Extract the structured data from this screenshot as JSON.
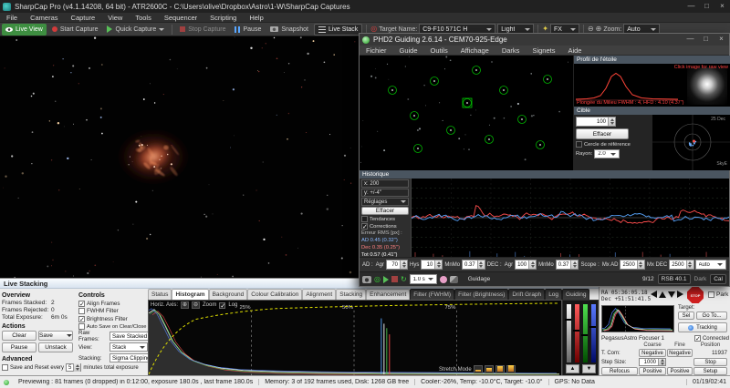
{
  "colors": {
    "accent_green": "#3e8e41",
    "ra_blue": "#58a6ff",
    "dec_red": "#ff4d4d",
    "stretch_yellow": "#e2e200",
    "stop_red": "#cf1f1f"
  },
  "sharpcap": {
    "title": "SharpCap Pro (v4.1.14208, 64 bit) - ATR2600C - C:\\Users\\olive\\Dropbox\\Astro\\1-W\\SharpCap Captures",
    "menus": [
      "File",
      "Cameras",
      "Capture",
      "View",
      "Tools",
      "Sequencer",
      "Scripting",
      "Help"
    ],
    "toolbar": {
      "live_view": "Live View",
      "start_capture": "Start Capture",
      "quick_capture": "Quick Capture",
      "stop_capture": "Stop Capture",
      "pause": "Pause",
      "snapshot": "Snapshot",
      "live_stack": "Live Stack",
      "target_name_label": "Target Name:",
      "target_name_value": "C9-F10 571C H",
      "frame_type_value": "Light",
      "fx_label": "FX",
      "zoom_label": "Zoom:",
      "zoom_value": "Auto"
    }
  },
  "phd2": {
    "title": "PHD2 Guiding 2.6.14 - CEM70-925-Edge",
    "menus": [
      "Fichier",
      "Guide",
      "Outils",
      "Affichage",
      "Darks",
      "Signets",
      "Aide"
    ],
    "star_profile": {
      "title": "Profil de l'étoile",
      "click_hint": "Click image for raw view",
      "fwhm_text": "Plongée du Milieu FWHM : 4, HFD : 4.10 (4.37\")"
    },
    "target": {
      "title": "Cible",
      "zoom_value": "100",
      "clear_button": "Effacer",
      "ref_circle_label": "Cercle de référence",
      "radius_label": "Rayon:",
      "radius_value": "2.0",
      "scale_label": "25 Dec",
      "east_label": "SkyE"
    },
    "graph": {
      "title": "Historique",
      "x_scale_label": "x: 200",
      "y_scale_label": "y: +/-4\"",
      "settings_button": "Réglages",
      "clear_button": "Effacer",
      "trends_label": "Tendances",
      "corrections_label": "Corrections",
      "rms_title": "Erreur RMS [px] :",
      "rms_ra": "AD 0.45 (0.32\")",
      "rms_dec": "Dec 0.35 (0.25\")",
      "rms_tot": "Tot 0.57 (0.41\")"
    },
    "params": {
      "ra_label": "AD :",
      "ra_agr_label": "Agr",
      "ra_agr_value": "70",
      "ra_hys_label": "Hys",
      "ra_hys_value": "10",
      "ra_mnmo_label": "MnMo",
      "ra_mnmo_value": "0.37",
      "dec_label": "DEC :",
      "dec_agr_label": "Agr",
      "dec_agr_value": "100",
      "dec_mnmo_label": "MnMo",
      "dec_mnmo_value": "0.37",
      "scope_label": "Scope :",
      "mxad_label": "Mx AD",
      "mxad_value": "2500",
      "mxdec_label": "Mx DEC",
      "mxdec_value": "2500",
      "mode_value": "Auto"
    },
    "footer": {
      "exposure_value": "1.0 s",
      "status_text": "Guidage",
      "frames_text": "9/12",
      "snr_text": "RSB 40.1",
      "dark_label": "Dark",
      "cal_label": "Cal"
    }
  },
  "live_stacking": {
    "panel_title": "Live Stacking",
    "overview": {
      "title": "Overview",
      "rows": [
        {
          "label": "Frames Stacked:",
          "value": "2"
        },
        {
          "label": "Frames Rejected:",
          "value": "0"
        },
        {
          "label": "Total Exposure:",
          "value": "6m 0s"
        }
      ]
    },
    "actions": {
      "title": "Actions",
      "buttons": [
        "Clear",
        "Save",
        "Pause",
        "Unstack"
      ]
    },
    "advanced": {
      "title": "Advanced",
      "save_reset_prefix": "Save and Reset every",
      "save_reset_value": "5",
      "save_reset_suffix": "minutes total exposure"
    },
    "controls": {
      "title": "Controls",
      "checkboxes": [
        {
          "label": "Align Frames",
          "checked": true
        },
        {
          "label": "FWHM Filter",
          "checked": false
        },
        {
          "label": "Brightness Filter",
          "checked": true
        },
        {
          "label": "Auto Save on Clear/Close",
          "checked": false
        }
      ],
      "dropdowns": [
        {
          "label": "Raw Frames:",
          "value": "Save Stacked"
        },
        {
          "label": "View:",
          "value": "Stack"
        },
        {
          "label": "Stacking:",
          "value": "Sigma Clipping"
        }
      ]
    },
    "tabs": [
      "Status",
      "Histogram",
      "Background",
      "Colour Calibration",
      "Alignment",
      "Stacking",
      "Enhancement",
      "Filter (FWHM)",
      "Filter (Brightness)",
      "Drift Graph",
      "Log",
      "Guiding"
    ],
    "selected_tab": "Histogram",
    "histogram": {
      "horiz_axis_label": "Horiz. Axis:",
      "zoom_label": "Zoom",
      "log_label": "Log",
      "percent_labels": [
        "25%",
        "50%",
        "75%"
      ],
      "stretch_mode_label": "Stretch Mode"
    }
  },
  "camera_panel": {
    "ra_value": "RA 05:36:05.18",
    "dec_value": "Dec +51:51:41.5",
    "stop_label": "STOP",
    "park_label": "Park",
    "target_label": "Target:",
    "sel_button": "Sel",
    "goto_button": "Go To...",
    "tracking_button": "Tracking",
    "focuser": {
      "title": "PegasusAstro Focuser 1",
      "connected_label": "Connected",
      "col_coarse": "Coarse",
      "col_fine": "Fine",
      "col_position": "Position",
      "tcom_label": "T. Com:",
      "neg_button": "Negative",
      "pos_button": "Positive",
      "position_value": "11937",
      "step_size_label": "Step Size:",
      "step_size_value": "1000",
      "stop_button": "Stop",
      "refocus_button": "Refocus",
      "setup_button": "Setup"
    }
  },
  "status_bar": {
    "sections": [
      "Previewing : 81 frames (0 dropped) in 0:12:00, exposure 180.0s , last frame 180.0s",
      "Memory: 3 of 192 frames used, Disk: 1268 GB free",
      "Cooler:-26%, Temp: -10.0°C, Target: -10.0°",
      "GPS: No Data"
    ],
    "time": "01/19/02:41"
  }
}
